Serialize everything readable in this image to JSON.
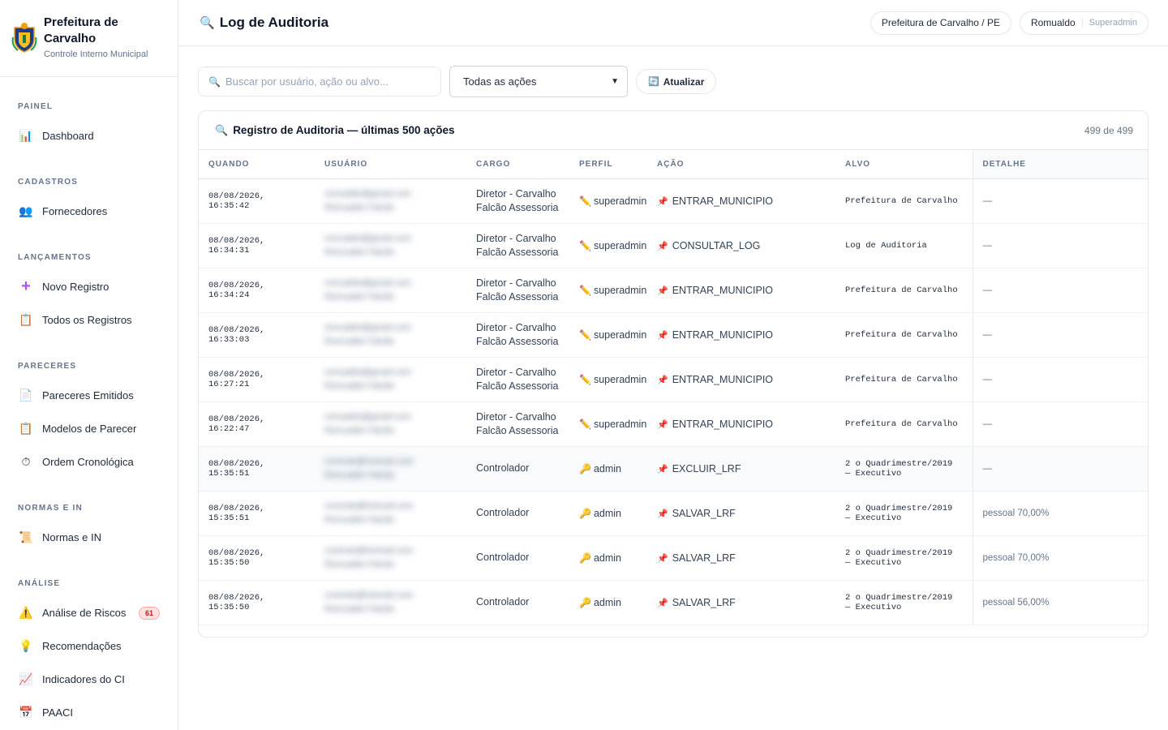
{
  "brand": {
    "title": "Prefeitura de Carvalho",
    "subtitle": "Controle Interno Municipal"
  },
  "sidebar": {
    "sections": [
      {
        "title": "PAINEL",
        "items": [
          {
            "label": "Dashboard",
            "icon": "bar-chart-icon"
          }
        ]
      },
      {
        "title": "CADASTROS",
        "items": [
          {
            "label": "Fornecedores",
            "icon": "users-icon"
          }
        ]
      },
      {
        "title": "LANÇAMENTOS",
        "items": [
          {
            "label": "Novo Registro",
            "icon": "plus-icon"
          },
          {
            "label": "Todos os Registros",
            "icon": "clipboard-icon"
          }
        ]
      },
      {
        "title": "PARECERES",
        "items": [
          {
            "label": "Pareceres Emitidos",
            "icon": "document-icon"
          },
          {
            "label": "Modelos de Parecer",
            "icon": "clipboard-icon"
          },
          {
            "label": "Ordem Cronológica",
            "icon": "stopwatch-icon"
          }
        ]
      },
      {
        "title": "NORMAS E IN",
        "items": [
          {
            "label": "Normas e IN",
            "icon": "scroll-icon"
          }
        ]
      },
      {
        "title": "ANÁLISE",
        "items": [
          {
            "label": "Análise de Riscos",
            "icon": "warning-icon",
            "badge": "61"
          },
          {
            "label": "Recomendações",
            "icon": "lightbulb-icon"
          },
          {
            "label": "Indicadores do CI",
            "icon": "trend-chart-icon"
          },
          {
            "label": "PAACI",
            "icon": "calendar-icon"
          }
        ]
      }
    ]
  },
  "header": {
    "title": "Log de Auditoria",
    "title_icon": "magnifier-icon",
    "municipio": "Prefeitura de Carvalho / PE",
    "user_name": "Romualdo",
    "user_role": "Superadmin"
  },
  "controls": {
    "search_placeholder": "Buscar por usuário, ação ou alvo...",
    "filter_selected": "Todas as ações",
    "refresh_label": "Atualizar"
  },
  "log": {
    "title": "Registro de Auditoria — últimas 500 ações",
    "count": "499 de 499",
    "columns": [
      "QUANDO",
      "USUÁRIO",
      "CARGO",
      "PERFIL",
      "AÇÃO",
      "ALVO",
      "DETALHE"
    ],
    "rows": [
      {
        "quando": "08/08/2026, 16:35:42",
        "usuario_email": "romualdo@gmail.com",
        "usuario_nome": "Romualdo Falcão",
        "cargo": "Diretor - Carvalho Falcão Assessoria",
        "perfil_icon": "pencil",
        "perfil": "superadmin",
        "acao": "ENTRAR_MUNICIPIO",
        "alvo": "Prefeitura de Carvalho",
        "detalhe": "—"
      },
      {
        "quando": "08/08/2026, 16:34:31",
        "usuario_email": "romualdo@gmail.com",
        "usuario_nome": "Romualdo Falcão",
        "cargo": "Diretor - Carvalho Falcão Assessoria",
        "perfil_icon": "pencil",
        "perfil": "superadmin",
        "acao": "CONSULTAR_LOG",
        "alvo": "Log de Auditoria",
        "detalhe": "—"
      },
      {
        "quando": "08/08/2026, 16:34:24",
        "usuario_email": "romualdo@gmail.com",
        "usuario_nome": "Romualdo Falcão",
        "cargo": "Diretor - Carvalho Falcão Assessoria",
        "perfil_icon": "pencil",
        "perfil": "superadmin",
        "acao": "ENTRAR_MUNICIPIO",
        "alvo": "Prefeitura de Carvalho",
        "detalhe": "—"
      },
      {
        "quando": "08/08/2026, 16:33:03",
        "usuario_email": "romualdo@gmail.com",
        "usuario_nome": "Romualdo Falcão",
        "cargo": "Diretor - Carvalho Falcão Assessoria",
        "perfil_icon": "pencil",
        "perfil": "superadmin",
        "acao": "ENTRAR_MUNICIPIO",
        "alvo": "Prefeitura de Carvalho",
        "detalhe": "—"
      },
      {
        "quando": "08/08/2026, 16:27:21",
        "usuario_email": "romualdo@gmail.com",
        "usuario_nome": "Romualdo Falcão",
        "cargo": "Diretor - Carvalho Falcão Assessoria",
        "perfil_icon": "pencil",
        "perfil": "superadmin",
        "acao": "ENTRAR_MUNICIPIO",
        "alvo": "Prefeitura de Carvalho",
        "detalhe": "—"
      },
      {
        "quando": "08/08/2026, 16:22:47",
        "usuario_email": "romualdo@gmail.com",
        "usuario_nome": "Romualdo Falcão",
        "cargo": "Diretor - Carvalho Falcão Assessoria",
        "perfil_icon": "pencil",
        "perfil": "superadmin",
        "acao": "ENTRAR_MUNICIPIO",
        "alvo": "Prefeitura de Carvalho",
        "detalhe": "—"
      },
      {
        "quando": "08/08/2026, 15:35:51",
        "usuario_email": "controle@hotmail.com",
        "usuario_nome": "Romualdo Falcão",
        "cargo": "Controlador",
        "perfil_icon": "key",
        "perfil": "admin",
        "acao": "EXCLUIR_LRF",
        "alvo": "2 o Quadrimestre/2019 — Executivo",
        "detalhe": "—",
        "highlight": true
      },
      {
        "quando": "08/08/2026, 15:35:51",
        "usuario_email": "controle@hotmail.com",
        "usuario_nome": "Romualdo Falcão",
        "cargo": "Controlador",
        "perfil_icon": "key",
        "perfil": "admin",
        "acao": "SALVAR_LRF",
        "alvo": "2 o Quadrimestre/2019 — Executivo",
        "detalhe": "pessoal 70,00%"
      },
      {
        "quando": "08/08/2026, 15:35:50",
        "usuario_email": "controle@hotmail.com",
        "usuario_nome": "Romualdo Falcão",
        "cargo": "Controlador",
        "perfil_icon": "key",
        "perfil": "admin",
        "acao": "SALVAR_LRF",
        "alvo": "2 o Quadrimestre/2019 — Executivo",
        "detalhe": "pessoal 70,00%"
      },
      {
        "quando": "08/08/2026, 15:35:50",
        "usuario_email": "controle@hotmail.com",
        "usuario_nome": "Romualdo Falcão",
        "cargo": "Controlador",
        "perfil_icon": "key",
        "perfil": "admin",
        "acao": "SALVAR_LRF",
        "alvo": "2 o Quadrimestre/2019 — Executivo",
        "detalhe": "pessoal 56,00%"
      }
    ]
  }
}
